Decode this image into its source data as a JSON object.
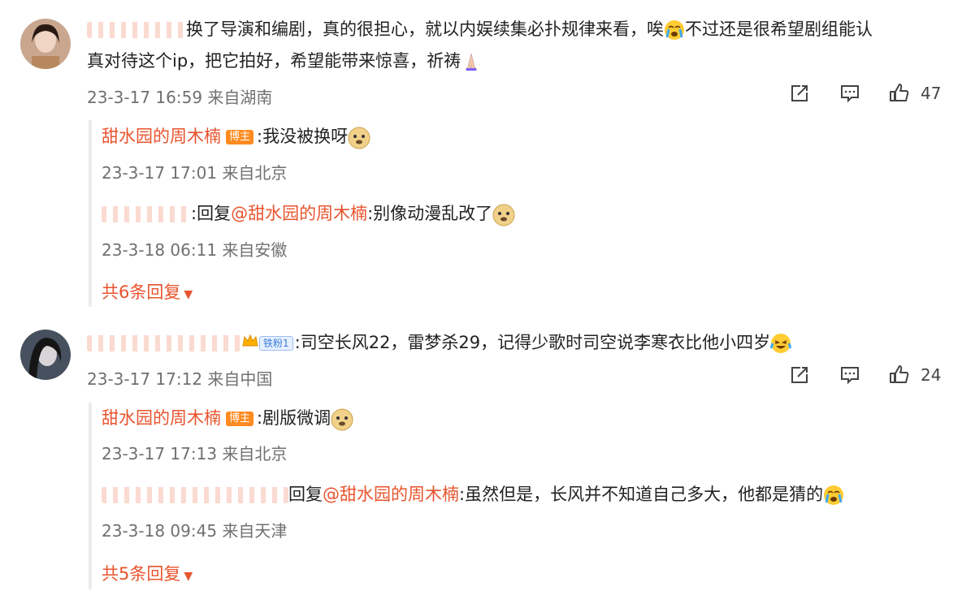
{
  "comments": [
    {
      "text_line1": "换了导演和编剧，真的很担心，就以内娱续集必扑规律来看，唉",
      "text_line1b": "不过还是很希望剧组能认",
      "text_line2": "真对待这个ip，把它拍好，希望能带来惊喜，祈祷",
      "meta": "23-3-17 16:59 来自湖南",
      "likes": "47",
      "replies": [
        {
          "name": "甜水园的周木楠",
          "badge": "博主",
          "text": ":我没被换呀",
          "meta": "23-3-17 17:01 来自北京"
        },
        {
          "prefix": ":回复",
          "mention": "@甜水园的周木楠",
          "text": ":别像动漫乱改了",
          "meta": "23-3-18 06:11 来自安徽"
        }
      ],
      "more": "共6条回复"
    },
    {
      "badge_fan": "铁粉1",
      "text": ":司空长风22，雷梦杀29，记得少歌时司空说李寒衣比他小四岁",
      "meta": "23-3-17 17:12 来自中国",
      "likes": "24",
      "replies": [
        {
          "name": "甜水园的周木楠",
          "badge": "博主",
          "text": ":剧版微调",
          "meta": "23-3-17 17:13 来自北京"
        },
        {
          "prefix": "回复",
          "mention": "@甜水园的周木楠",
          "text": ":虽然但是，长风并不知道自己多大，他都是猜的",
          "meta": "23-3-18 09:45 来自天津"
        }
      ],
      "more": "共5条回复"
    }
  ],
  "icons": {
    "share": "share-icon",
    "comment": "comment-icon",
    "like": "like-icon",
    "dropdown": "caret-down-icon"
  },
  "colors": {
    "accent": "#e8542e",
    "meta": "#707070"
  }
}
